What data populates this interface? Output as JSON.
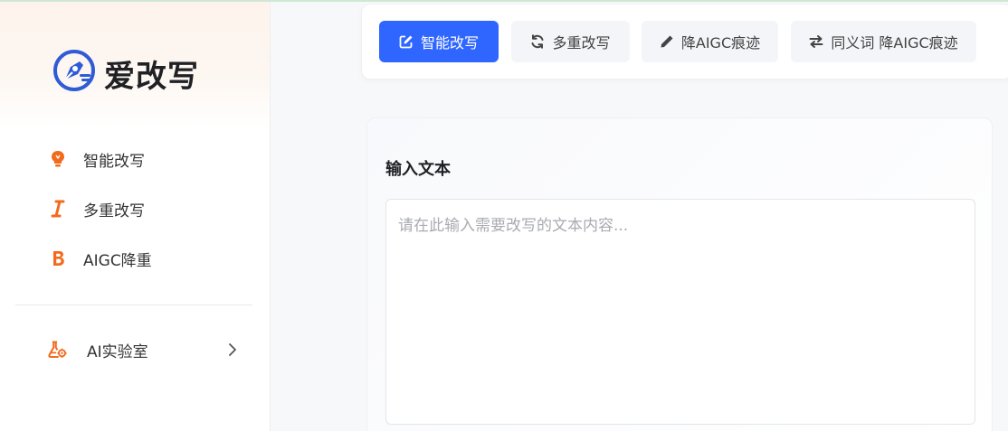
{
  "brand": {
    "name": "爱改写",
    "accent": "#2f66ff",
    "nav_icon_color": "#f26b1d"
  },
  "sidebar": {
    "items": [
      {
        "label": "智能改写",
        "icon": "lightbulb-icon"
      },
      {
        "label": "多重改写",
        "icon": "italic-icon"
      },
      {
        "label": "AIGC降重",
        "icon": "bold-icon"
      }
    ],
    "lab": {
      "label": "AI实验室",
      "icon": "flask-gear-icon"
    }
  },
  "toolbar": {
    "tabs": [
      {
        "label": "智能改写",
        "icon": "edit-icon",
        "active": true
      },
      {
        "label": "多重改写",
        "icon": "refresh-icon",
        "active": false
      },
      {
        "label": "降AIGC痕迹",
        "icon": "pencil-icon",
        "active": false
      },
      {
        "label": "同义词 降AIGC痕迹",
        "icon": "swap-icon",
        "active": false
      }
    ]
  },
  "input": {
    "title": "输入文本",
    "value": "",
    "placeholder": "请在此输入需要改写的文本内容..."
  }
}
